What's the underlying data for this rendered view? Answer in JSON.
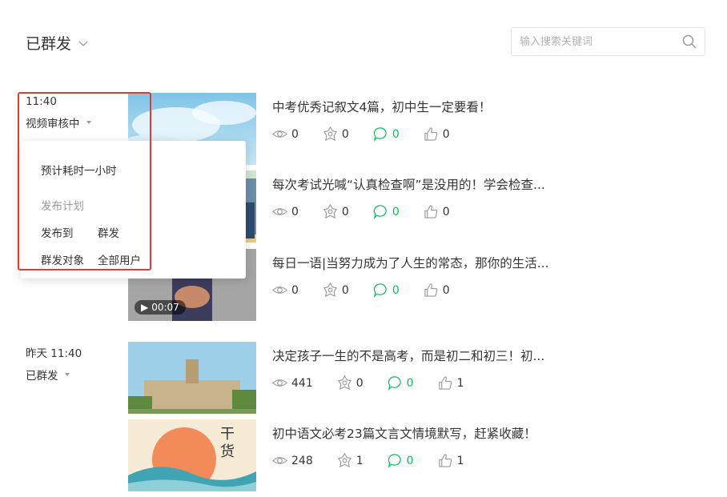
{
  "header": {
    "title": "已群发"
  },
  "search": {
    "placeholder": "输入搜索关键词"
  },
  "groups": [
    {
      "time": "11:40",
      "status": "视频审核中",
      "articles": [
        {
          "title": "中考优秀记叙文4篇，初中生一定要看！",
          "views": "0",
          "shares": "0",
          "comments": "0",
          "likes": "0"
        },
        {
          "title": "每次考试光喊“认真检查啊”是没用的！学会检查...",
          "views": "0",
          "shares": "0",
          "comments": "0",
          "likes": "0"
        },
        {
          "title": "每日一语|当努力成为了人生的常态，那你的生活...",
          "views": "0",
          "shares": "0",
          "comments": "0",
          "likes": "0",
          "duration": "00:07"
        }
      ]
    },
    {
      "time": "昨天 11:40",
      "status": "已群发",
      "articles": [
        {
          "title": "决定孩子一生的不是高考，而是初二和初三！初...",
          "views": "441",
          "shares": "0",
          "comments": "0",
          "likes": "1"
        },
        {
          "title": "初中语文必考23篇文言文情境默写，赶紧收藏！",
          "views": "248",
          "shares": "1",
          "comments": "0",
          "likes": "1",
          "thumb_text": "干货"
        }
      ]
    }
  ],
  "popover": {
    "estimate": "预计耗时一小时",
    "plan_label": "发布计划",
    "publish_to_label": "发布到",
    "publish_to_value": "群发",
    "target_label": "群发对象",
    "target_value": "全部用户"
  },
  "colors": {
    "comment_green": "#07c160",
    "highlight_red": "#e53935"
  }
}
